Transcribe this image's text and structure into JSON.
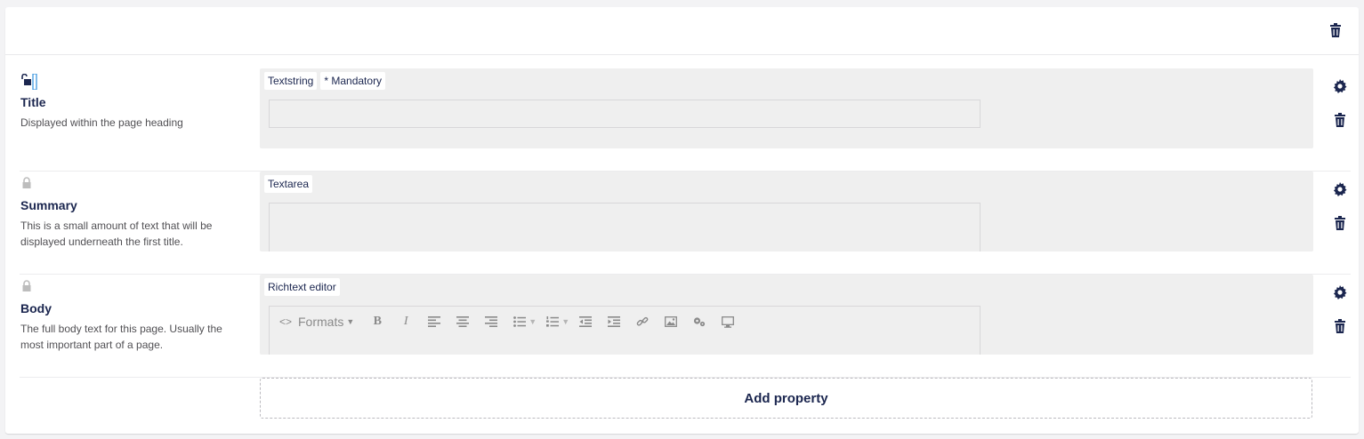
{
  "toolbar": {
    "delete_icon": "trash-icon"
  },
  "properties": [
    {
      "label": "Title",
      "description": "Displayed within the page heading",
      "lock_state": "unlocked",
      "tags": [
        "Textstring",
        "* Mandatory"
      ],
      "editor_type": "textstring"
    },
    {
      "label": "Summary",
      "description": "This is a small amount of text that will be displayed underneath the first title.",
      "lock_state": "locked",
      "tags": [
        "Textarea"
      ],
      "editor_type": "textarea"
    },
    {
      "label": "Body",
      "description": "The full body text for this page. Usually the most important part of a page.",
      "lock_state": "locked",
      "tags": [
        "Richtext editor"
      ],
      "editor_type": "richtext"
    }
  ],
  "rte": {
    "formats_label": "Formats",
    "buttons": [
      "source-code-icon",
      "bold-icon",
      "italic-icon",
      "align-left-icon",
      "align-center-icon",
      "align-right-icon",
      "bullet-list-icon",
      "numbered-list-icon",
      "outdent-icon",
      "indent-icon",
      "link-icon",
      "image-icon",
      "macro-icon",
      "embed-icon"
    ]
  },
  "add_property_label": "Add property",
  "colors": {
    "text": "#1b264f",
    "editor_bg": "#efefef",
    "muted": "#515054"
  }
}
